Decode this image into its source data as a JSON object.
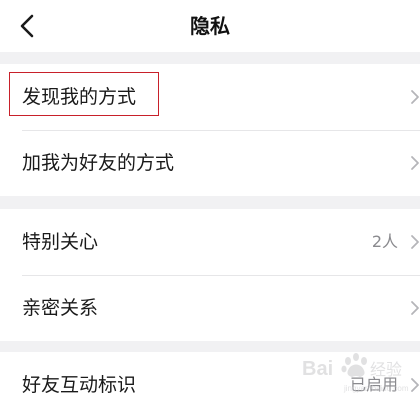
{
  "nav": {
    "title": "隐私"
  },
  "groups": [
    {
      "items": [
        {
          "label": "发现我的方式",
          "value": ""
        },
        {
          "label": "加我为好友的方式",
          "value": ""
        }
      ]
    },
    {
      "items": [
        {
          "label": "特别关心",
          "value": "2人"
        },
        {
          "label": "亲密关系",
          "value": ""
        }
      ]
    },
    {
      "items": [
        {
          "label": "好友互动标识",
          "value": "已启用"
        }
      ]
    }
  ],
  "icons": {
    "back": "chevron-left-icon",
    "row_arrow": "chevron-right-icon"
  },
  "colors": {
    "background": "#f1f1f3",
    "highlight_border": "#c8202a",
    "secondary_text": "#8a8a8e"
  },
  "watermark": {
    "text": "Bai百度经验"
  }
}
